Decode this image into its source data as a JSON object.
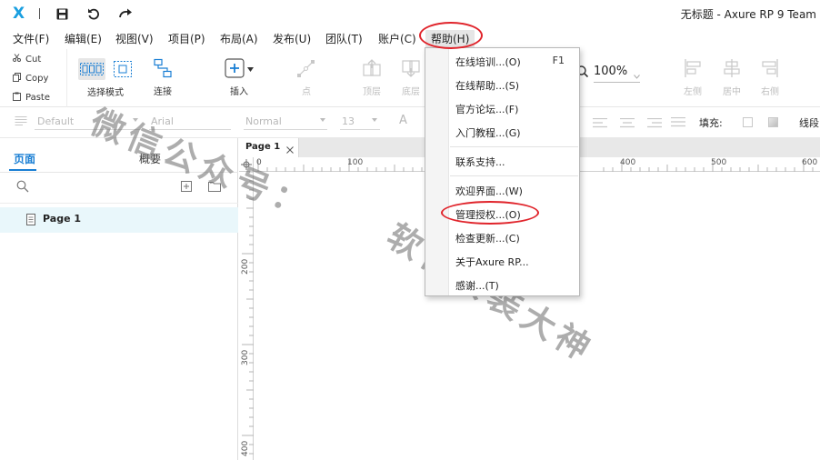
{
  "titlebar": {
    "logo": "X",
    "title": "无标题 - Axure RP 9 Team"
  },
  "menubar": {
    "items": [
      "文件(F)",
      "编辑(E)",
      "视图(V)",
      "项目(P)",
      "布局(A)",
      "发布(U)",
      "团队(T)",
      "账户(C)",
      "帮助(H)"
    ]
  },
  "clipboard": {
    "cut": "Cut",
    "copy": "Copy",
    "paste": "Paste"
  },
  "toolbar": {
    "select_mode": "选择模式",
    "connect": "连接",
    "insert": "插入",
    "point": "点",
    "top_layer": "顶层",
    "bottom_layer": "底层",
    "zoom": "100%",
    "left_align": "左侧",
    "center_align": "居中",
    "right_align": "右侧"
  },
  "stylebar": {
    "style": "Default",
    "font": "Arial",
    "weight": "Normal",
    "size": "13",
    "font_icon": "A",
    "fill_label": "填充:",
    "line_label": "线段"
  },
  "leftpanel": {
    "tab_pages": "页面",
    "tab_outline": "概要",
    "page_name": "Page 1"
  },
  "canvas": {
    "tab_name": "Page 1",
    "ruler_h": [
      "0",
      "100",
      "400",
      "500",
      "600"
    ],
    "ruler_v": [
      "200",
      "300",
      "400"
    ]
  },
  "help_menu": {
    "items": [
      {
        "label": "在线培训...(O)",
        "shortcut": "F1"
      },
      {
        "label": "在线帮助...(S)",
        "shortcut": ""
      },
      {
        "label": "官方论坛...(F)",
        "shortcut": ""
      },
      {
        "label": "入门教程...(G)",
        "shortcut": ""
      },
      {
        "label": "联系支持...",
        "shortcut": ""
      },
      {
        "label": "欢迎界面...(W)",
        "shortcut": ""
      },
      {
        "label": "管理授权...(O)",
        "shortcut": ""
      },
      {
        "label": "检查更新...(C)",
        "shortcut": ""
      },
      {
        "label": "关于Axure RP...",
        "shortcut": ""
      },
      {
        "label": "感谢...(T)",
        "shortcut": ""
      }
    ]
  },
  "watermark": {
    "line1": "微信公众号：",
    "line2": "软件安装大神"
  },
  "colors": {
    "accent": "#1a7fd4",
    "logo": "#1a9fe0",
    "highlight_ring": "#e0242b",
    "selected_row": "#e9f7fb"
  }
}
